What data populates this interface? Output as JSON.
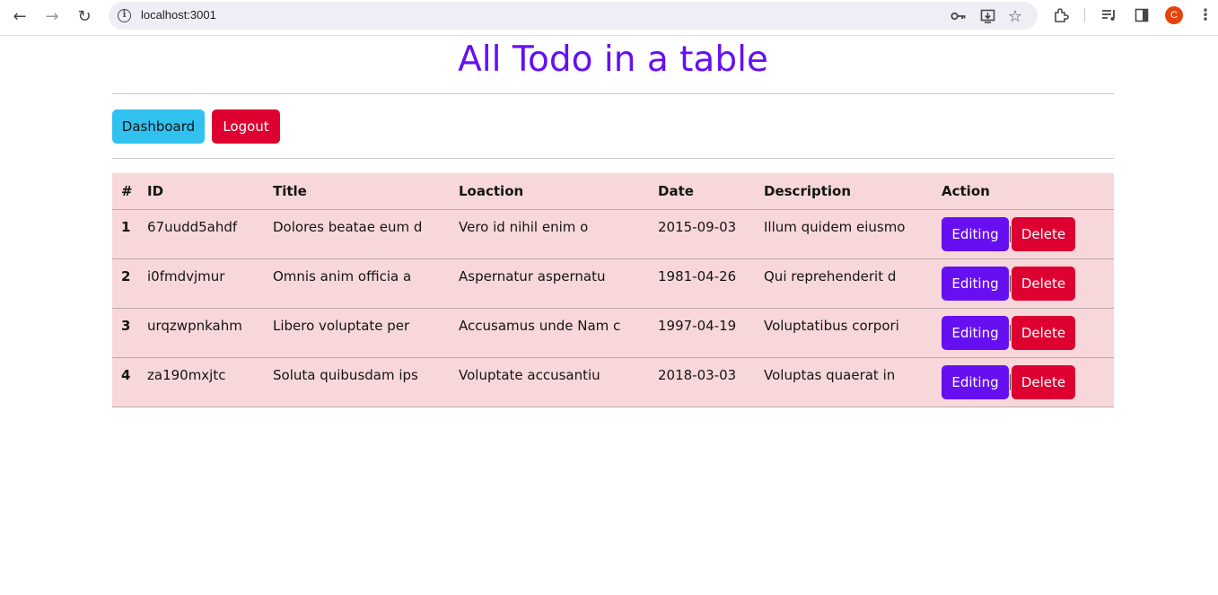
{
  "browser": {
    "url": "localhost:3001",
    "avatar_letter": "C"
  },
  "page": {
    "title": "All Todo in a table",
    "dashboard_label": "Dashboard",
    "logout_label": "Logout"
  },
  "colors": {
    "title": "#6610f2",
    "dashboard_button": "#31c1ef",
    "logout_button": "#dd0031",
    "editing_button": "#6610f2",
    "delete_button": "#dd0031",
    "table_background": "#f8d7da"
  },
  "table": {
    "headers": [
      "#",
      "ID",
      "Title",
      "Loaction",
      "Date",
      "Description",
      "Action"
    ],
    "rows": [
      {
        "num": "1",
        "id": "67uudd5ahdf",
        "title": "Dolores beatae eum d",
        "location": "Vero id nihil enim o",
        "date": "2015-09-03",
        "description": "Illum quidem eiusmo",
        "edit_label": "Editing",
        "delete_label": "Delete"
      },
      {
        "num": "2",
        "id": "i0fmdvjmur",
        "title": "Omnis anim officia a",
        "location": "Aspernatur aspernatu",
        "date": "1981-04-26",
        "description": "Qui reprehenderit d",
        "edit_label": "Editing",
        "delete_label": "Delete"
      },
      {
        "num": "3",
        "id": "urqzwpnkahm",
        "title": "Libero voluptate per",
        "location": "Accusamus unde Nam c",
        "date": "1997-04-19",
        "description": "Voluptatibus corpori",
        "edit_label": "Editing",
        "delete_label": "Delete"
      },
      {
        "num": "4",
        "id": "za190mxjtc",
        "title": "Soluta quibusdam ips",
        "location": "Voluptate accusantiu",
        "date": "2018-03-03",
        "description": "Voluptas quaerat in",
        "edit_label": "Editing",
        "delete_label": "Delete"
      }
    ]
  }
}
